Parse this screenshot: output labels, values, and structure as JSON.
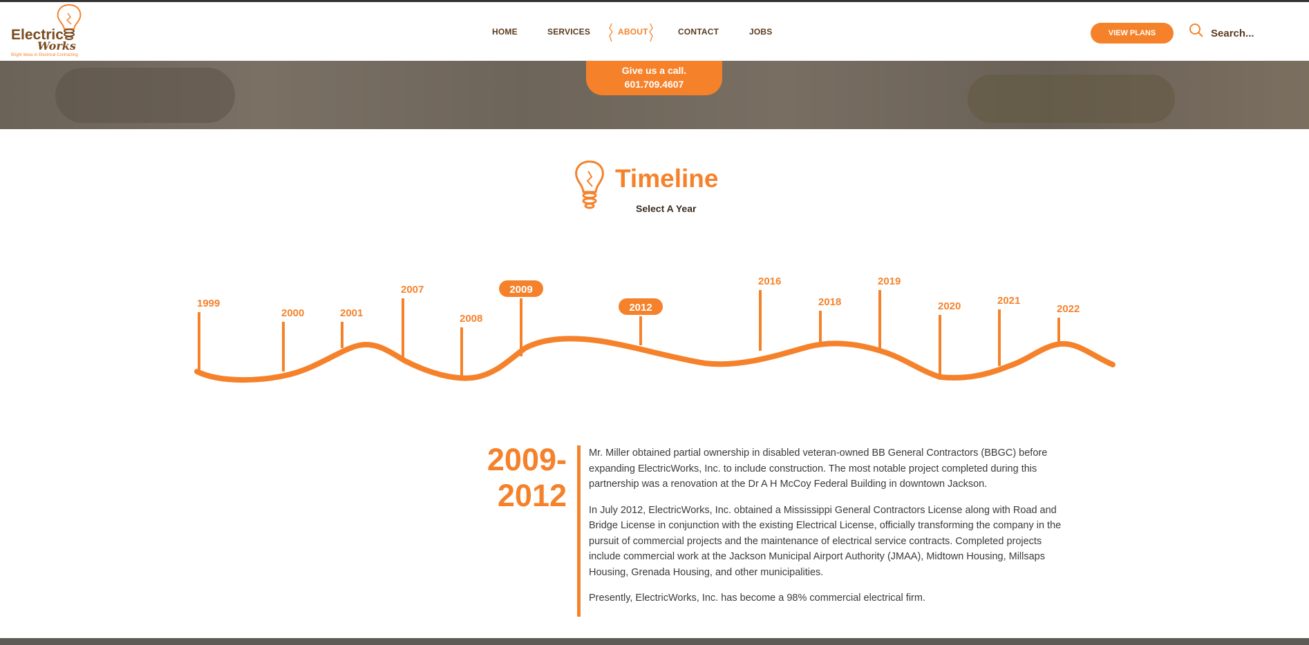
{
  "brand": {
    "name_line1": "Electric",
    "name_line2": "Works",
    "tagline": "Bright Ideas in Electrical Contracting",
    "accent_color": "#f5822b",
    "brown_color": "#5a3a1e"
  },
  "nav": {
    "items": [
      "HOME",
      "SERVICES",
      "ABOUT",
      "CONTACT",
      "JOBS"
    ],
    "active": "ABOUT"
  },
  "header": {
    "cta_label": "VIEW PLANS",
    "search_placeholder": "Search..."
  },
  "call": {
    "line1": "Give us a call.",
    "phone": "601.709.4607"
  },
  "timeline": {
    "title": "Timeline",
    "subtitle": "Select A Year",
    "years": [
      "1999",
      "2000",
      "2001",
      "2007",
      "2008",
      "2009",
      "2012",
      "2016",
      "2018",
      "2019",
      "2020",
      "2021",
      "2022"
    ],
    "selected_years": [
      "2009",
      "2012"
    ]
  },
  "detail": {
    "period_start": "2009-",
    "period_end": "2012",
    "paragraphs": [
      "Mr. Miller obtained partial ownership in disabled veteran-owned BB General Contractors (BBGC) before expanding ElectricWorks, Inc. to include construction. The most notable project completed during this partnership was a renovation at the Dr A H McCoy Federal Building in downtown Jackson.",
      "In July 2012, ElectricWorks, Inc. obtained a Mississippi General Contractors License along with Road and Bridge License in conjunction with the existing Electrical License, officially transforming the company in the pursuit of commercial projects and the maintenance of electrical service contracts. Completed projects include commercial work at the Jackson Municipal Airport Authority (JMAA), Midtown Housing, Millsaps Housing, Grenada Housing, and other municipalities.",
      "Presently, ElectricWorks, Inc. has become a 98% commercial electrical firm."
    ]
  }
}
